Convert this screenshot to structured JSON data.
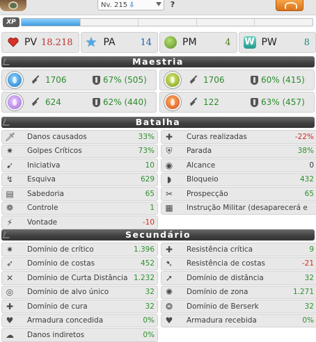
{
  "header": {
    "level_label": "Nv. 215",
    "help_label": "?"
  },
  "xp": {
    "badge": "XP",
    "progress": 0.2
  },
  "main_stats": [
    {
      "icon": "heart-icon",
      "label": "PV",
      "value": "18.218",
      "color": "#c0302a"
    },
    {
      "icon": "star-icon",
      "label": "PA",
      "value": "14",
      "color": "#1f5fb0"
    },
    {
      "icon": "movement-icon",
      "label": "PM",
      "value": "4",
      "color": "#4c7d1b"
    },
    {
      "icon": "wakfu-icon",
      "label": "PW",
      "value": "8",
      "color": "#1e8a7f"
    }
  ],
  "sections": {
    "mastery": "Maestria",
    "battle": "Batalha",
    "secondary": "Secundário"
  },
  "mastery": [
    {
      "element": "water",
      "mastery": "1706",
      "resistance": "67% (505)"
    },
    {
      "element": "earth",
      "mastery": "1706",
      "resistance": "60% (415)"
    },
    {
      "element": "air",
      "mastery": "624",
      "resistance": "62% (440)"
    },
    {
      "element": "fire",
      "mastery": "122",
      "resistance": "63% (457)"
    }
  ],
  "battle": [
    {
      "icon": "sword-icon",
      "label": "Danos causados",
      "value": "33%",
      "tone": "pos"
    },
    {
      "icon": "heal-icon",
      "label": "Curas realizadas",
      "value": "-22%",
      "tone": "neg"
    },
    {
      "icon": "critical-icon",
      "label": "Golpes Críticos",
      "value": "73%",
      "tone": "pos"
    },
    {
      "icon": "shield-icon",
      "label": "Parada",
      "value": "38%",
      "tone": "pos"
    },
    {
      "icon": "initiative-icon",
      "label": "Iniciativa",
      "value": "10",
      "tone": "pos"
    },
    {
      "icon": "eye-icon",
      "label": "Alcance",
      "value": "0",
      "tone": "neu"
    },
    {
      "icon": "dodge-icon",
      "label": "Esquiva",
      "value": "629",
      "tone": "pos"
    },
    {
      "icon": "block-icon",
      "label": "Bloqueio",
      "value": "432",
      "tone": "pos"
    },
    {
      "icon": "book-icon",
      "label": "Sabedoria",
      "value": "65",
      "tone": "pos"
    },
    {
      "icon": "prospection-icon",
      "label": "Prospecção",
      "value": "65",
      "tone": "pos"
    },
    {
      "icon": "paw-icon",
      "label": "Controle",
      "value": "1",
      "tone": "pos"
    },
    {
      "icon": "military-icon",
      "label": "Instrução Militar (desaparecerá e",
      "value": "",
      "tone": "neu"
    },
    {
      "icon": "will-icon",
      "label": "Vontade",
      "value": "-10",
      "tone": "neg"
    },
    {
      "icon": "",
      "label": "",
      "value": "",
      "tone": "empty"
    }
  ],
  "secondary": [
    {
      "icon": "crit-mastery-icon",
      "label": "Domínio de crítico",
      "value": "1.396",
      "tone": "pos"
    },
    {
      "icon": "crit-resist-icon",
      "label": "Resistência crítica",
      "value": "9",
      "tone": "pos"
    },
    {
      "icon": "rear-mastery-icon",
      "label": "Domínio de costas",
      "value": "452",
      "tone": "pos"
    },
    {
      "icon": "rear-resist-icon",
      "label": "Resistência de costas",
      "value": "-21",
      "tone": "neg"
    },
    {
      "icon": "melee-icon",
      "label": "Domínio de Curta Distância",
      "value": "1.232",
      "tone": "pos"
    },
    {
      "icon": "distance-icon",
      "label": "Domínio de distância",
      "value": "32",
      "tone": "pos"
    },
    {
      "icon": "target-icon",
      "label": "Domínio de alvo único",
      "value": "32",
      "tone": "pos"
    },
    {
      "icon": "area-icon",
      "label": "Domínio de zona",
      "value": "1.271",
      "tone": "pos"
    },
    {
      "icon": "heal-mastery-icon",
      "label": "Domínio de cura",
      "value": "32",
      "tone": "pos"
    },
    {
      "icon": "berserk-icon",
      "label": "Domínio de Berserk",
      "value": "32",
      "tone": "pos"
    },
    {
      "icon": "armor-given-icon",
      "label": "Armadura concedida",
      "value": "0%",
      "tone": "pos"
    },
    {
      "icon": "armor-received-icon",
      "label": "Armadura recebida",
      "value": "0%",
      "tone": "pos"
    },
    {
      "icon": "indirect-icon",
      "label": "Danos indiretos",
      "value": "0%",
      "tone": "pos"
    },
    {
      "icon": "",
      "label": "",
      "value": "",
      "tone": "empty"
    }
  ]
}
